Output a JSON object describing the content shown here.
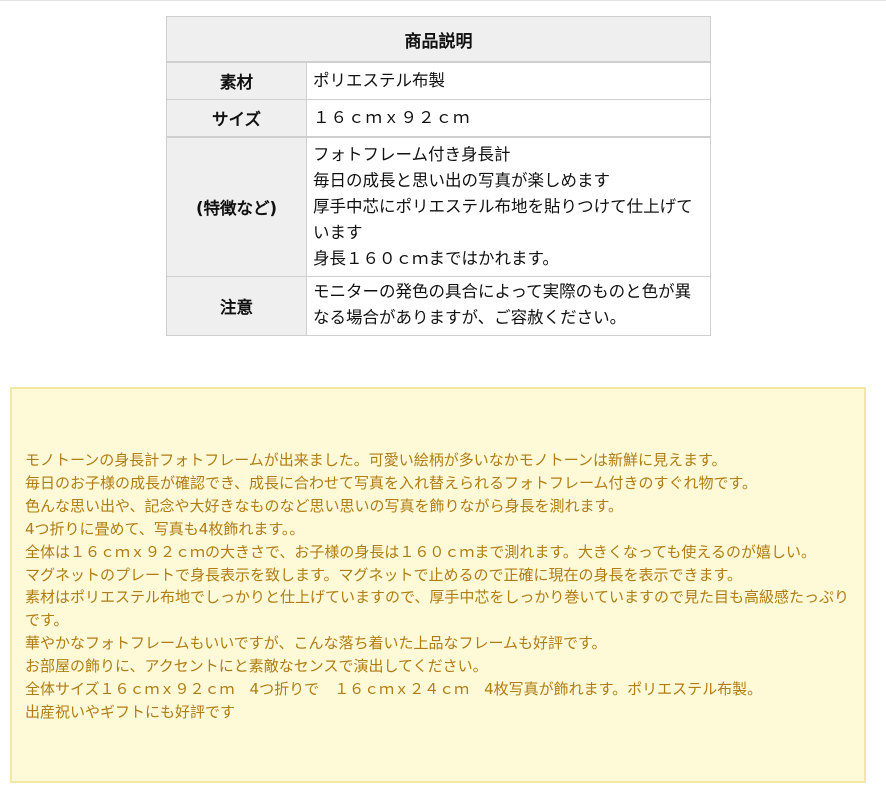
{
  "spec_table": {
    "caption": "商品説明",
    "rows": [
      {
        "label": "素材",
        "lines": [
          "ポリエステル布製"
        ]
      },
      {
        "label": "サイズ",
        "lines": [
          "１６ｃｍｘ９２ｃｍ"
        ]
      },
      {
        "label": "(特徴など)",
        "lines": [
          "フォトフレーム付き身長計",
          "毎日の成長と思い出の写真が楽しめます",
          "厚手中芯にポリエステル布地を貼りつけて仕上げています",
          "身長１６０ｃｍまではかれます。"
        ]
      },
      {
        "label": "注意",
        "lines": [
          "モニターの発色の具合によって実際のものと色が異なる場合がありますが、ご容赦ください。"
        ]
      }
    ]
  },
  "description": {
    "lines": [
      "モノトーンの身長計フォトフレームが出来ました。可愛い絵柄が多いなかモノトーンは新鮮に見えます。",
      "毎日のお子様の成長が確認でき、成長に合わせて写真を入れ替えられるフォトフレーム付きのすぐれ物です。",
      "色んな思い出や、記念や大好きなものなど思い思いの写真を飾りながら身長を測れます。",
      "4つ折りに畳めて、写真も4枚飾れます。。",
      "全体は１６ｃｍｘ９２ｃｍの大きさで、お子様の身長は１６０ｃｍまで測れます。大きくなっても使えるのが嬉しい。",
      "マグネットのプレートで身長表示を致します。マグネットで止めるので正確に現在の身長を表示できます。",
      "素材はポリエステル布地でしっかりと仕上げていますので、厚手中芯をしっかり巻いていますので見た目も高級感たっぷりです。",
      "華やかなフォトフレームもいいですが、こんな落ち着いた上品なフレームも好評です。",
      "お部屋の飾りに、アクセントにと素敵なセンスで演出してください。",
      "全体サイズ１６ｃｍｘ９２ｃｍ　4つ折りで　１６ｃｍｘ２４ｃｍ　4枚写真が飾れます。ポリエステル布製。",
      "出産祝いやギフトにも好評です"
    ],
    "text_color": "#b07d14",
    "background": "#fef9d6"
  }
}
